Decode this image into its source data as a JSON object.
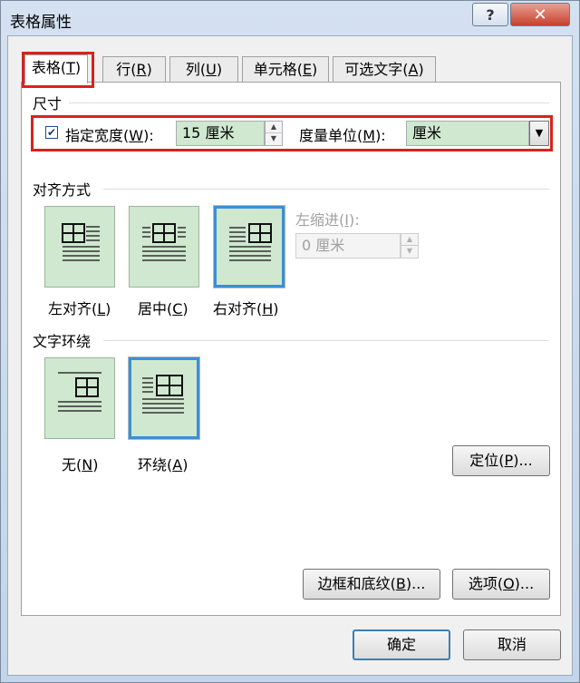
{
  "window": {
    "title": "表格属性",
    "help_label": "?",
    "close_label": "✕"
  },
  "tabs": [
    {
      "label": "表格(",
      "key": "T",
      "end": ")"
    },
    {
      "label": "行(",
      "key": "R",
      "end": ")"
    },
    {
      "label": "列(",
      "key": "U",
      "end": ")"
    },
    {
      "label": "单元格(",
      "key": "E",
      "end": ")"
    },
    {
      "label": "可选文字(",
      "key": "A",
      "end": ")"
    }
  ],
  "size": {
    "heading": "尺寸",
    "preferred_width": {
      "label": "指定宽度(",
      "key": "W",
      "end": "):",
      "checked": true,
      "check_glyph": "✔"
    },
    "width_value": "15 厘米",
    "unit": {
      "label": "度量单位(",
      "key": "M",
      "end": "):",
      "value": "厘米"
    }
  },
  "alignment": {
    "heading": "对齐方式",
    "options": [
      {
        "label": "左对齐(",
        "key": "L",
        "end": ")",
        "selected": false
      },
      {
        "label": "居中(",
        "key": "C",
        "end": ")",
        "selected": false
      },
      {
        "label": "右对齐(",
        "key": "H",
        "end": ")",
        "selected": true
      }
    ],
    "indent": {
      "label": "左缩进(",
      "key": "I",
      "end": "):",
      "value": "0 厘米",
      "enabled": false
    }
  },
  "wrapping": {
    "heading": "文字环绕",
    "options": [
      {
        "label": "无(",
        "key": "N",
        "end": ")",
        "selected": false
      },
      {
        "label": "环绕(",
        "key": "A",
        "end": ")",
        "selected": true
      }
    ],
    "position_button": {
      "label": "定位(",
      "key": "P",
      "end": ")..."
    }
  },
  "buttons": {
    "borders": {
      "label": "边框和底纹(",
      "key": "B",
      "end": ")..."
    },
    "options": {
      "label": "选项(",
      "key": "O",
      "end": ")..."
    },
    "ok": "确定",
    "cancel": "取消"
  },
  "colors": {
    "highlight": "#d9221c",
    "option_fill": "#cfe8cf",
    "selected_border": "#3b8fd8"
  }
}
